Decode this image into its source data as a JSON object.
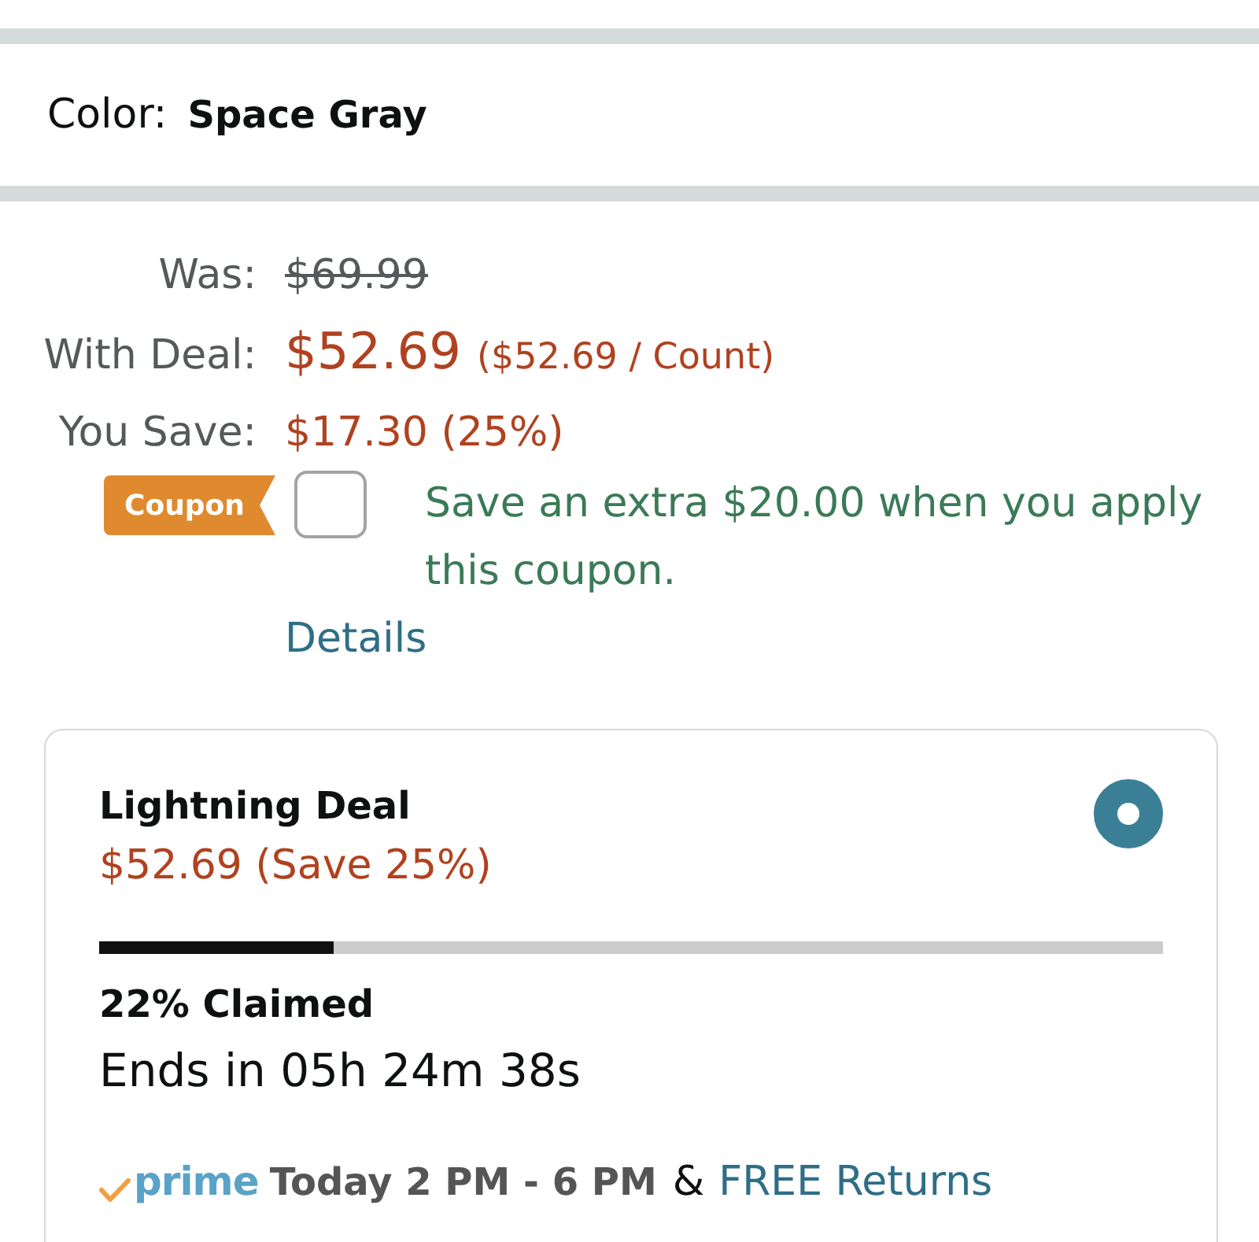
{
  "color_selector": {
    "label": "Color:",
    "value": "Space Gray"
  },
  "price_rows": [
    {
      "kind": "was",
      "label": "Was:",
      "price": "$69.99"
    },
    {
      "kind": "deal",
      "label": "With Deal:",
      "price": "$52.69",
      "unit_price": "($52.69 / Count)"
    },
    {
      "kind": "save",
      "label": "You Save:",
      "price": "$17.30 (25%)"
    }
  ],
  "coupon": {
    "badge": "Coupon",
    "checked": false,
    "text": "Save an extra $20.00 when you apply this coupon.",
    "link": "Details"
  },
  "lightning_deal": {
    "title": "Lightning Deal",
    "price": "$52.69 (Save 25%)",
    "selected": true,
    "level": 0.22,
    "claimed": "22% Claimed",
    "ends": "Ends in 05h 24m 38s",
    "delivery": {
      "logo": "prime",
      "window": "Today 2 PM - 6 PM",
      "separator": "&",
      "link": "FREE Returns"
    }
  }
}
